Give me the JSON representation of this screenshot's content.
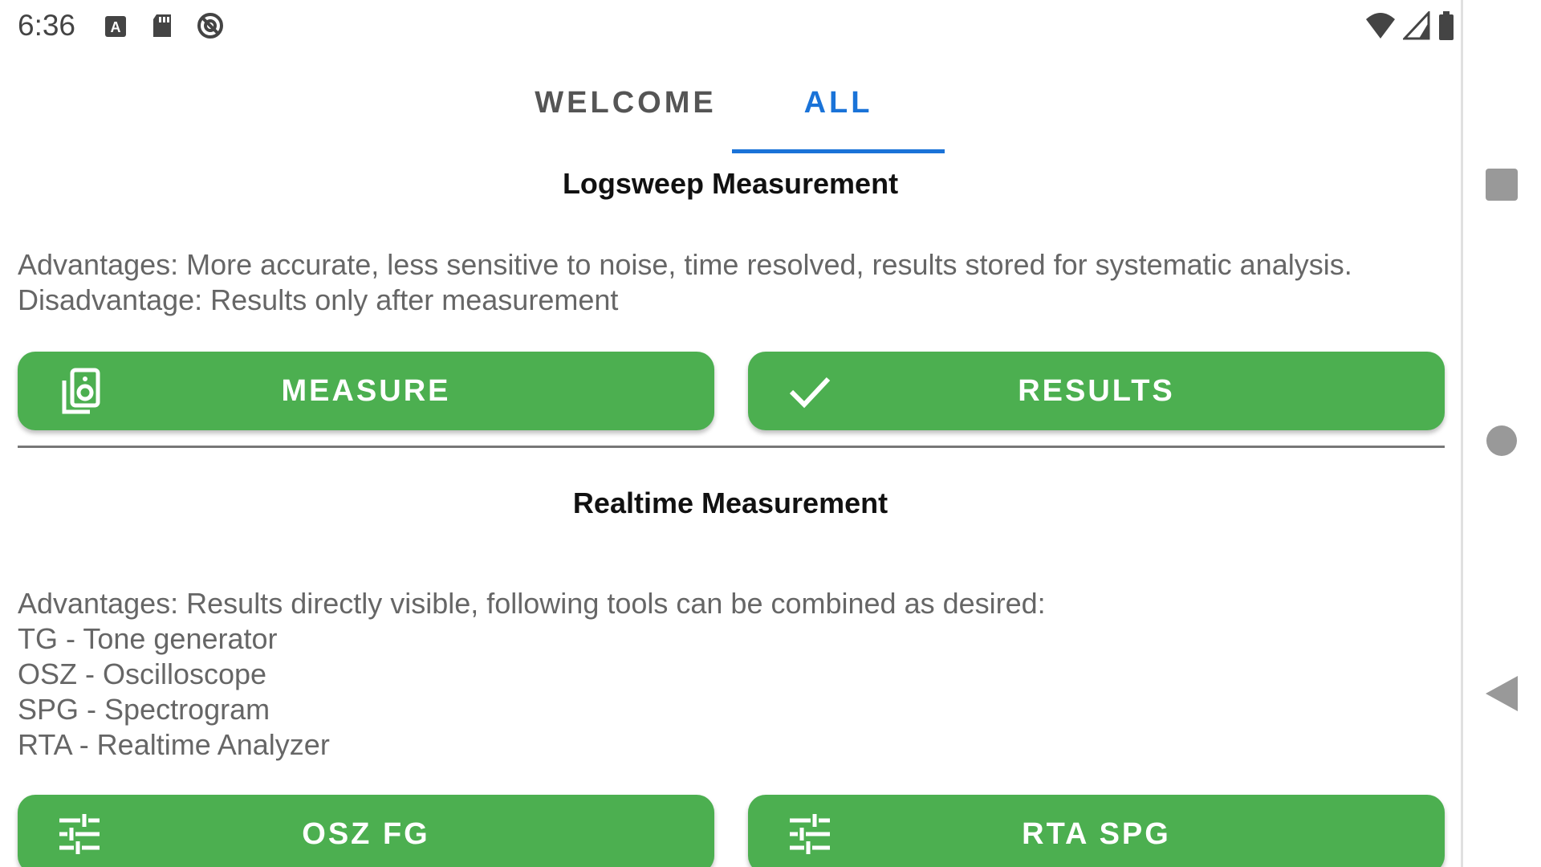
{
  "status_bar": {
    "time": "6:36",
    "left_icons": [
      "keyboard-a-icon",
      "sd-card-icon",
      "no-signal-icon"
    ],
    "right_icons": [
      "wifi-icon",
      "cell-signal-icon",
      "battery-icon"
    ]
  },
  "tabs": [
    {
      "label": "WELCOME",
      "selected": false
    },
    {
      "label": "ALL",
      "selected": true
    }
  ],
  "colors": {
    "accent": "#1a73d8",
    "button": "#4caf50",
    "text_muted": "#666666"
  },
  "logsweep": {
    "title": "Logsweep Measurement",
    "desc_line1": "Advantages: More accurate, less sensitive to noise, time resolved, results stored for systematic analysis.",
    "desc_line2": "Disadvantage: Results only after measurement",
    "measure_label": "MEASURE",
    "results_label": "RESULTS"
  },
  "realtime": {
    "title": "Realtime Measurement",
    "desc_lines": [
      "Advantages: Results directly visible, following tools can be combined as desired:",
      "TG - Tone generator",
      "OSZ - Oscilloscope",
      "SPG - Spectrogram",
      "RTA - Realtime Analyzer"
    ],
    "osz_fg_label": "OSZ FG",
    "rta_spg_label": "RTA SPG"
  },
  "nav": {
    "icons": [
      "recents-icon",
      "home-icon",
      "back-icon"
    ]
  }
}
